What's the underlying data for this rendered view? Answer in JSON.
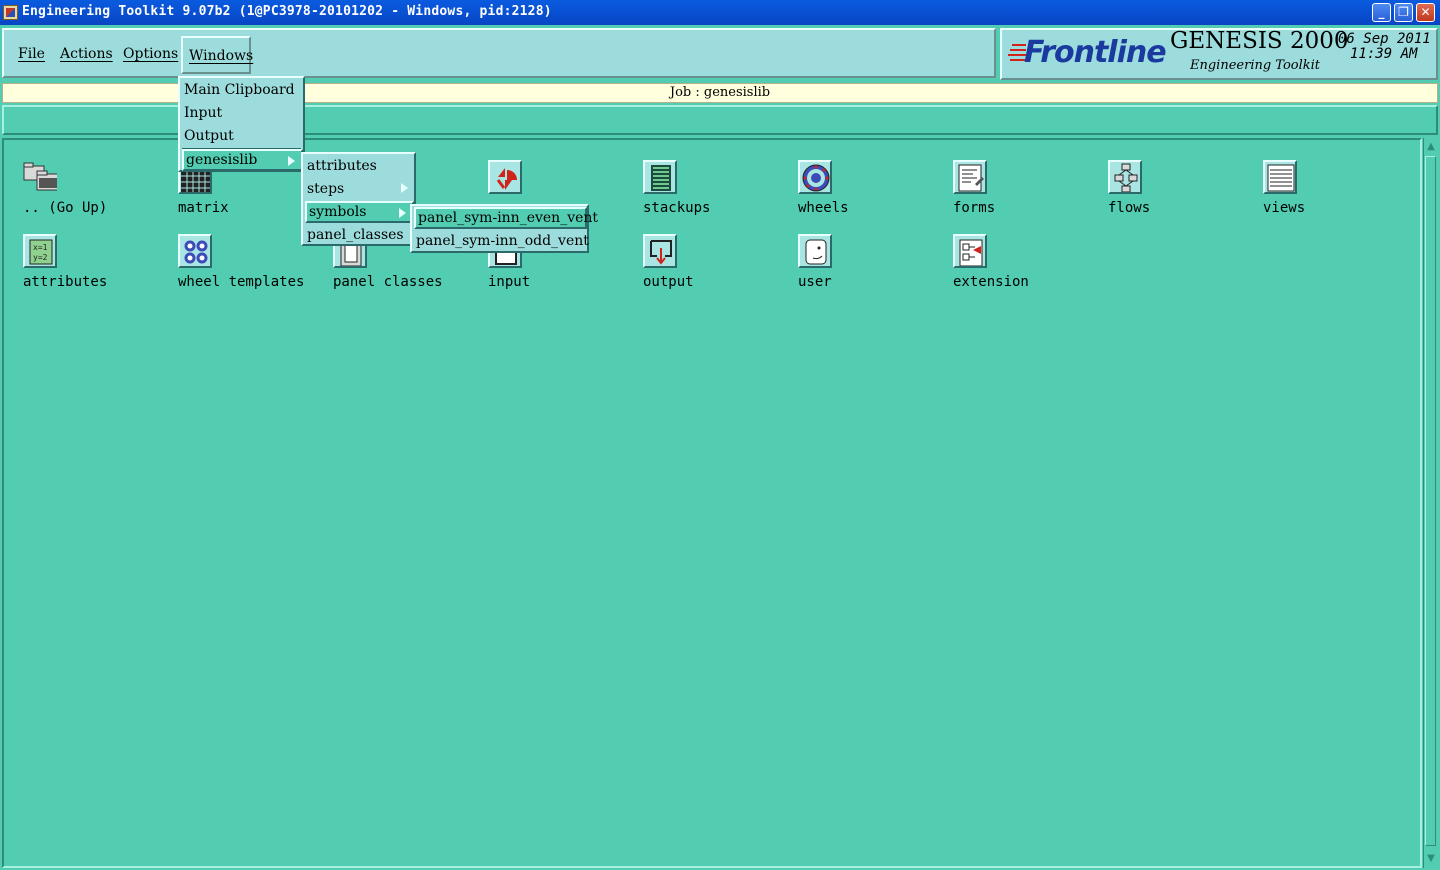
{
  "window": {
    "title": "Engineering Toolkit 9.07b2 (1@PC3978-20101202 - Windows, pid:2128)",
    "buttons": [
      "minimize",
      "maximize",
      "close"
    ]
  },
  "menubar": {
    "file": "File",
    "actions": "Actions",
    "options": "Options",
    "windows": "Windows"
  },
  "logo": {
    "brand": "Frontline",
    "product": "GENESIS 2000",
    "subtitle": "Engineering Toolkit",
    "date": "06 Sep 2011",
    "time": "11:39 AM"
  },
  "job": {
    "label": "Job : genesislib"
  },
  "items": [
    {
      "label": ".. (Go Up)",
      "icon": "folder-up-icon"
    },
    {
      "label": "matrix",
      "icon": "matrix-grid-icon"
    },
    {
      "label": "",
      "icon": "hidden-icon"
    },
    {
      "label": "",
      "icon": "symbol-red-icon"
    },
    {
      "label": "stackups",
      "icon": "stackup-icon"
    },
    {
      "label": "wheels",
      "icon": "wheel-icon"
    },
    {
      "label": "forms",
      "icon": "form-icon"
    },
    {
      "label": "flows",
      "icon": "flow-icon"
    },
    {
      "label": "views",
      "icon": "views-icon"
    },
    {
      "label": "attributes",
      "icon": "attributes-icon"
    },
    {
      "label": "wheel templates",
      "icon": "wheel-templates-icon"
    },
    {
      "label": "panel classes",
      "icon": "panel-classes-icon"
    },
    {
      "label": "input",
      "icon": "input-icon"
    },
    {
      "label": "output",
      "icon": "output-icon"
    },
    {
      "label": "user",
      "icon": "user-icon"
    },
    {
      "label": "extension",
      "icon": "extension-icon"
    }
  ],
  "windows_menu": {
    "items": [
      "Main Clipboard",
      "Input",
      "Output"
    ],
    "genesislib": "genesislib"
  },
  "genesislib_menu": {
    "attributes": "attributes",
    "steps": "steps",
    "symbols": "symbols",
    "panel_classes": "panel_classes"
  },
  "symbols_menu": {
    "even": "panel_sym-inn_even_vent",
    "odd": "panel_sym-inn_odd_vent"
  }
}
